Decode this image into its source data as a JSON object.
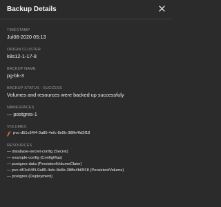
{
  "dialog": {
    "title": "Backup Details",
    "close_icon": "close-icon"
  },
  "timestamp": {
    "label": "TIMESTAMP",
    "value": "Jul08-2020 05:13"
  },
  "origin_cluster": {
    "label": "ORIGIN CLUSTER",
    "value": "k8s12-1-17-8"
  },
  "backup_name": {
    "label": "BACKUP NAME",
    "value": "pg-bk-3"
  },
  "backup_status": {
    "label": "BACKUP STATUS - SUCCESS",
    "value": "Volumes and resources were backed up successfuly"
  },
  "namespaces": {
    "label": "NAMESPACES",
    "items": [
      "— postgres-1"
    ]
  },
  "volumes": {
    "label": "VOLUMES",
    "icon": "volume-link-icon",
    "icon_color": "#e8772e",
    "items": [
      "pvc-d51c64f4-0a85-4efc-8e5b-38ffe4fd3f18"
    ]
  },
  "resources": {
    "label": "RESOURCES",
    "items": [
      "— database-secret-config (Secret)",
      "— example-config (ConfigMap)",
      "— postgres-data (PersistentVolumeClaim)",
      "— pvc-d51c64f4-0a85-4efc-8e5b-38ffe4fd3f18 (PersistentVolume)",
      "— postgres (Deployment)"
    ]
  }
}
